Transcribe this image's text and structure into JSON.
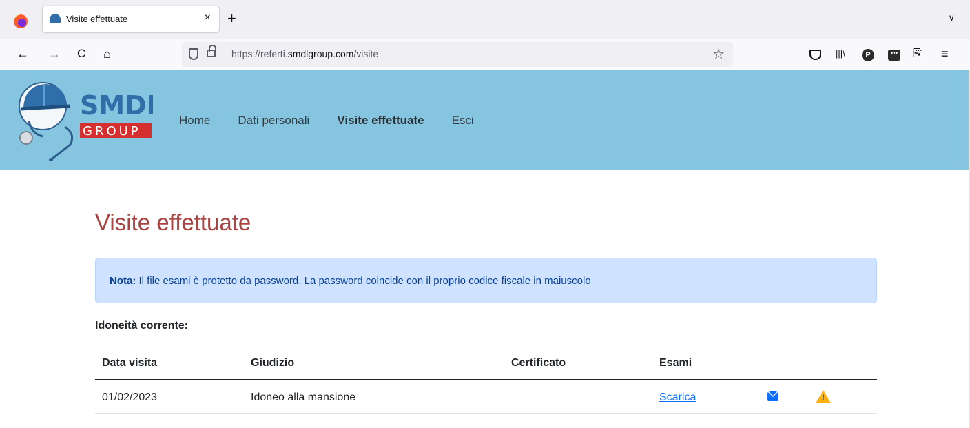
{
  "browser": {
    "tab_title": "Visite effettuate",
    "tab_close": "×",
    "new_tab": "+",
    "tab_list": "∨",
    "url_prefix": "https://referti.",
    "url_domain": "smdlgroup.com",
    "url_path": "/visite",
    "nav": {
      "back": "←",
      "forward": "→",
      "reload": "C",
      "home": "⌂"
    },
    "bookmark_star": "☆",
    "toolbar": {
      "library": "|||\\",
      "p_badge": "P",
      "dots": "•••",
      "share": "⎘",
      "menu": "≡"
    },
    "icons": [
      "firefox-icon",
      "favicon-icon",
      "shield-icon",
      "lock-icon",
      "star-icon",
      "pocket-icon",
      "library-icon",
      "p-extension-icon",
      "dots-extension-icon",
      "share-icon",
      "menu-icon"
    ]
  },
  "site": {
    "logo": {
      "line1": "SMDL",
      "line2": "GROUP"
    },
    "nav": [
      {
        "label": "Home",
        "active": false
      },
      {
        "label": "Dati personali",
        "active": false
      },
      {
        "label": "Visite effettuate",
        "active": true
      },
      {
        "label": "Esci",
        "active": false
      }
    ],
    "colors": {
      "header_bg": "#85c5e0",
      "title": "#a94442",
      "note_bg": "#cfe2ff",
      "link": "#0d6efd",
      "warning": "#ffb20f"
    }
  },
  "main": {
    "title": "Visite effettuate",
    "note": {
      "label": "Nota:",
      "text": " Il file esami è protetto da password. La password coincide con il proprio codice fiscale in maiuscolo"
    },
    "subheading": "Idoneità corrente:",
    "table": {
      "headers": [
        "Data visita",
        "Giudizio",
        "Certificato",
        "Esami"
      ],
      "rows": [
        {
          "data_visita": "01/02/2023",
          "giudizio": "Idoneo alla mansione",
          "certificato": "",
          "esami": "Scarica",
          "icons": [
            "envelope-icon",
            "warning-icon"
          ]
        }
      ]
    }
  }
}
